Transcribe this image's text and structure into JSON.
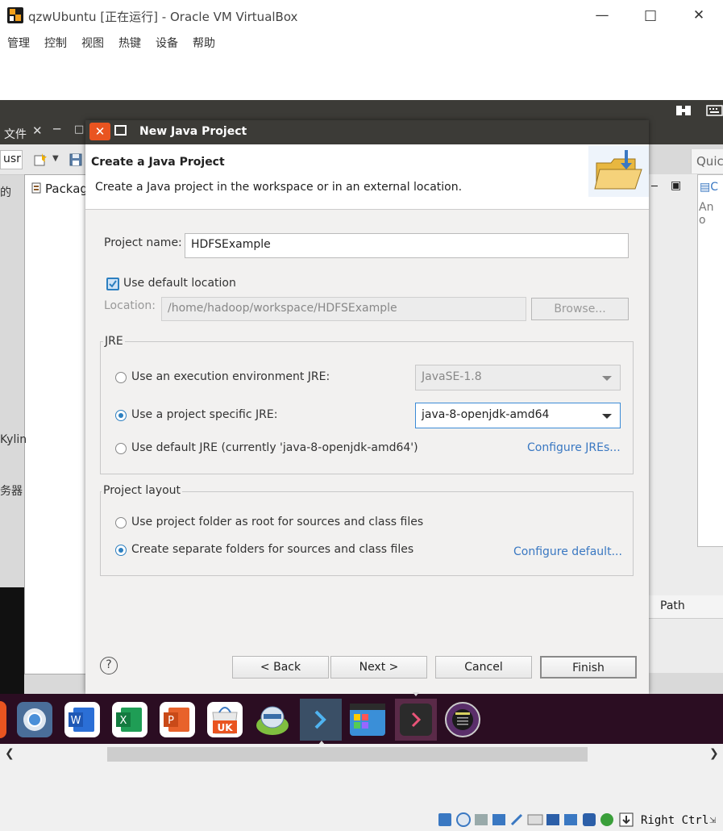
{
  "host": {
    "title": "qzwUbuntu [正在运行] - Oracle VM VirtualBox",
    "menu": [
      "管理",
      "控制",
      "视图",
      "热键",
      "设备",
      "帮助"
    ],
    "status_key": "Right Ctrl"
  },
  "eclipse": {
    "menu_file": "文件",
    "perspective_usr": "usr",
    "left_side_chars": [
      "的",
      "Kylin",
      "务器"
    ],
    "package_explorer": "Packag",
    "quick_access": "Quic",
    "outline_prefix": "An o",
    "path_col": "Path"
  },
  "dialog": {
    "title": "New Java Project",
    "header_title": "Create a Java Project",
    "header_desc": "Create a Java project in the workspace or in an external location.",
    "project_name_label": "Project name:",
    "project_name_value": "HDFSExample",
    "use_default_location_label": "Use default location",
    "use_default_location_checked": true,
    "location_label": "Location:",
    "location_value": "/home/hadoop/workspace/HDFSExample",
    "browse_label": "Browse...",
    "jre": {
      "group_label": "JRE",
      "option_exec_env": "Use an execution environment JRE:",
      "exec_env_value": "JavaSE-1.8",
      "option_project_specific": "Use a project specific JRE:",
      "project_specific_value": "java-8-openjdk-amd64",
      "option_default": "Use default JRE (currently 'java-8-openjdk-amd64')",
      "configure_link": "Configure JREs...",
      "selected": "project_specific"
    },
    "layout": {
      "group_label": "Project layout",
      "option_root": "Use project folder as root for sources and class files",
      "option_separate": "Create separate folders for sources and class files",
      "configure_link": "Configure default...",
      "selected": "separate"
    },
    "buttons": {
      "help": "?",
      "back": "< Back",
      "next": "Next >",
      "cancel": "Cancel",
      "finish": "Finish"
    }
  },
  "dock": {
    "apps": [
      "ubuntu-software-icon",
      "chromium-icon",
      "wps-writer-icon",
      "wps-spreadsheet-icon",
      "wps-presentation-icon",
      "ubuntu-kylin-software-icon",
      "software-updater-icon",
      "vscode-icon",
      "workspace-switcher-icon",
      "terminal-icon",
      "disk-icon"
    ]
  },
  "colors": {
    "accent_orange": "#e95420",
    "ubuntu_dark": "#3c3b37",
    "dock_bg": "#2b0d22",
    "link_blue": "#3a78c2",
    "radio_blue": "#2c7fc0"
  }
}
